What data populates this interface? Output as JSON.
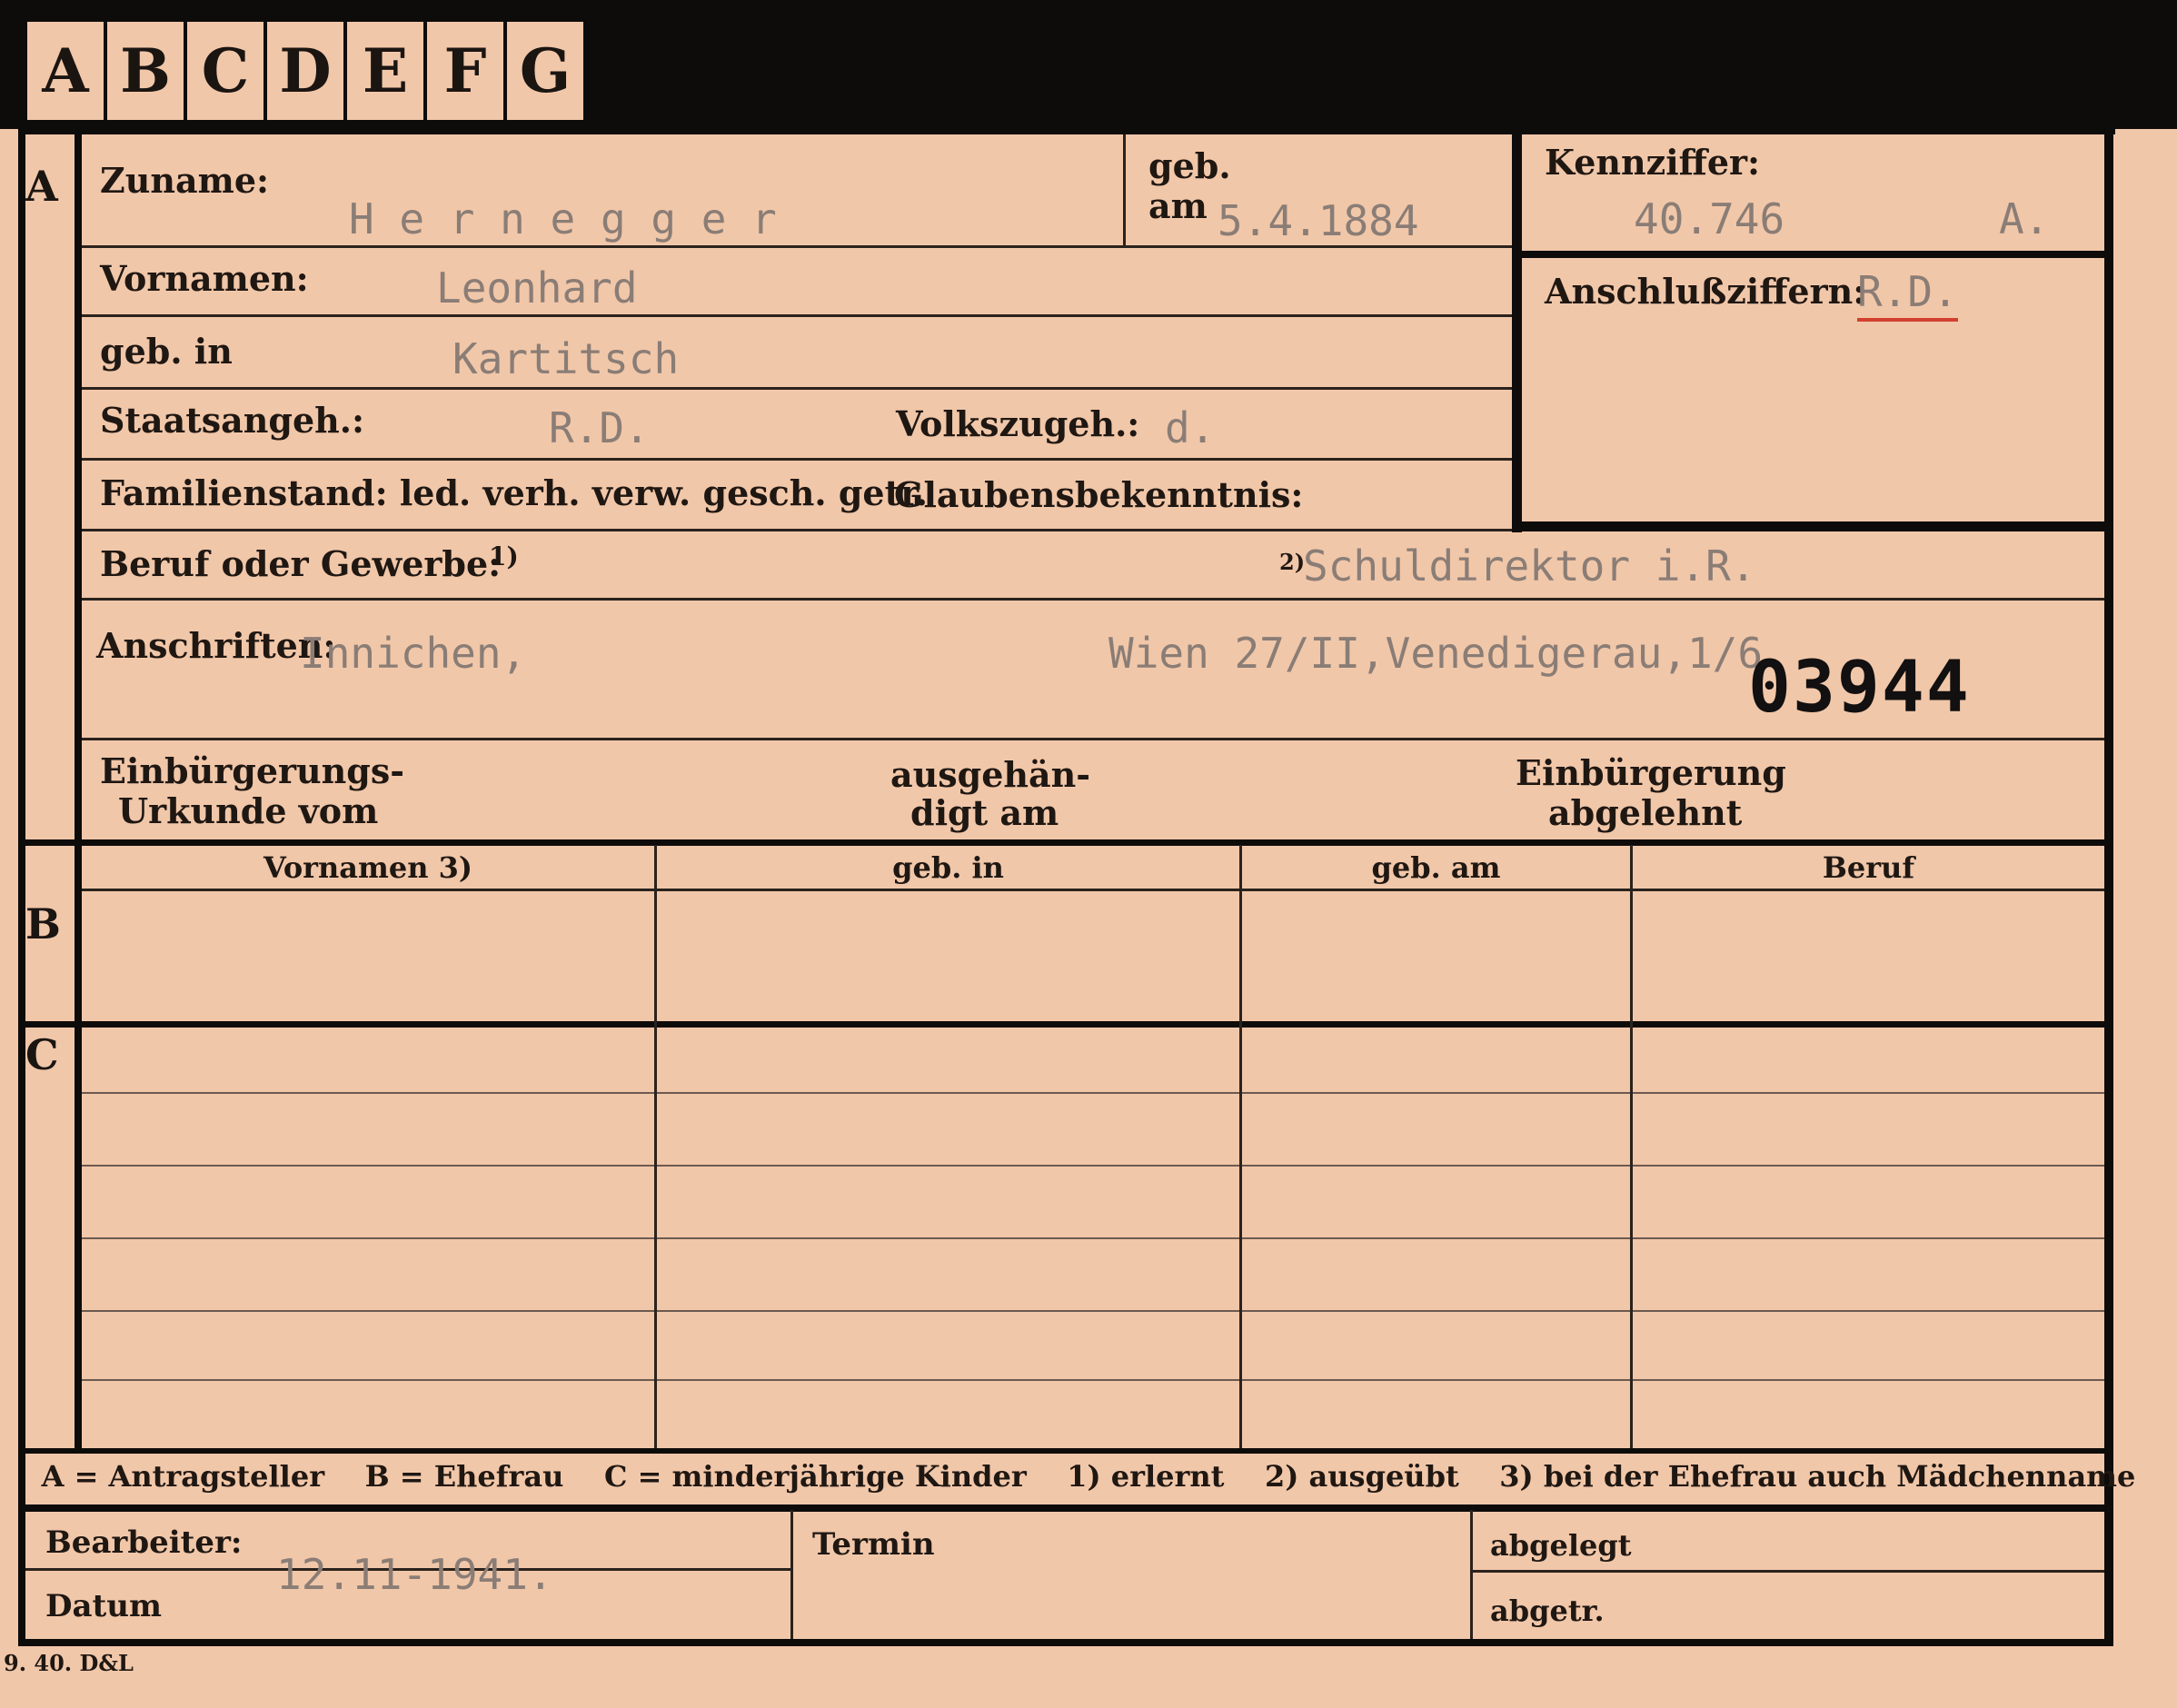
{
  "tabs": [
    "A",
    "B",
    "C",
    "D",
    "E",
    "F",
    "G"
  ],
  "section_letters": {
    "a": "A",
    "b": "B",
    "c": "C"
  },
  "fields": {
    "zuname": {
      "label": "Zuname:",
      "value": "H e r n e g g e r"
    },
    "geb_am": {
      "label_1": "geb.",
      "label_2": "am",
      "value": "5.4.1884"
    },
    "kennziffer": {
      "label": "Kennziffer:",
      "value": "40.746",
      "suffix": "A."
    },
    "vornamen": {
      "label": "Vornamen:",
      "value": "Leonhard"
    },
    "anschlussziffern": {
      "label": "Anschlußziffern:",
      "value": "R.D."
    },
    "geb_in": {
      "label": "geb. in",
      "value": "Kartitsch"
    },
    "staatsangeh": {
      "label": "Staatsangeh.:",
      "value": "R.D."
    },
    "volkszugeh": {
      "label": "Volkszugeh.:",
      "value": "d."
    },
    "familienstand": {
      "label": "Familienstand: led. verh. verw. gesch. getr."
    },
    "glaubensbekenntnis": {
      "label": "Glaubensbekenntnis:"
    },
    "beruf": {
      "label": "Beruf oder Gewerbe:",
      "mark_1": "1)",
      "mark_2": "2)",
      "value": "Schuldirektor i.R."
    },
    "anschriften": {
      "label": "Anschriften:",
      "value_1": "Innichen,",
      "value_2": "Wien 27/II,Venedigerau,1/6"
    },
    "stamp_number": "03944",
    "einbuergerung": {
      "urkunde_1": "Einbürgerungs-",
      "urkunde_2": "Urkunde vom",
      "ausgehaendigt_1": "ausgehän-",
      "ausgehaendigt_2": "digt am",
      "abgelehnt_1": "Einbürgerung",
      "abgelehnt_2": "abgelehnt"
    }
  },
  "table": {
    "headers": [
      "Vornamen 3)",
      "geb. in",
      "geb. am",
      "Beruf"
    ]
  },
  "legend": "A = Antragsteller    B = Ehefrau    C = minderjährige Kinder    1) erlernt    2) ausgeübt    3) bei der Ehefrau auch Mädchenname",
  "bottom": {
    "bearbeiter": "Bearbeiter:",
    "datum": "Datum",
    "datum_value": "12.11-1941.",
    "termin": "Termin",
    "abgelegt": "abgelegt",
    "abgetr": "abgetr."
  },
  "print_code": "9. 40. D&L",
  "colors": {
    "card": "#f1c7a9",
    "border": "#0e0c0b",
    "underline_red": "#d2412f"
  }
}
